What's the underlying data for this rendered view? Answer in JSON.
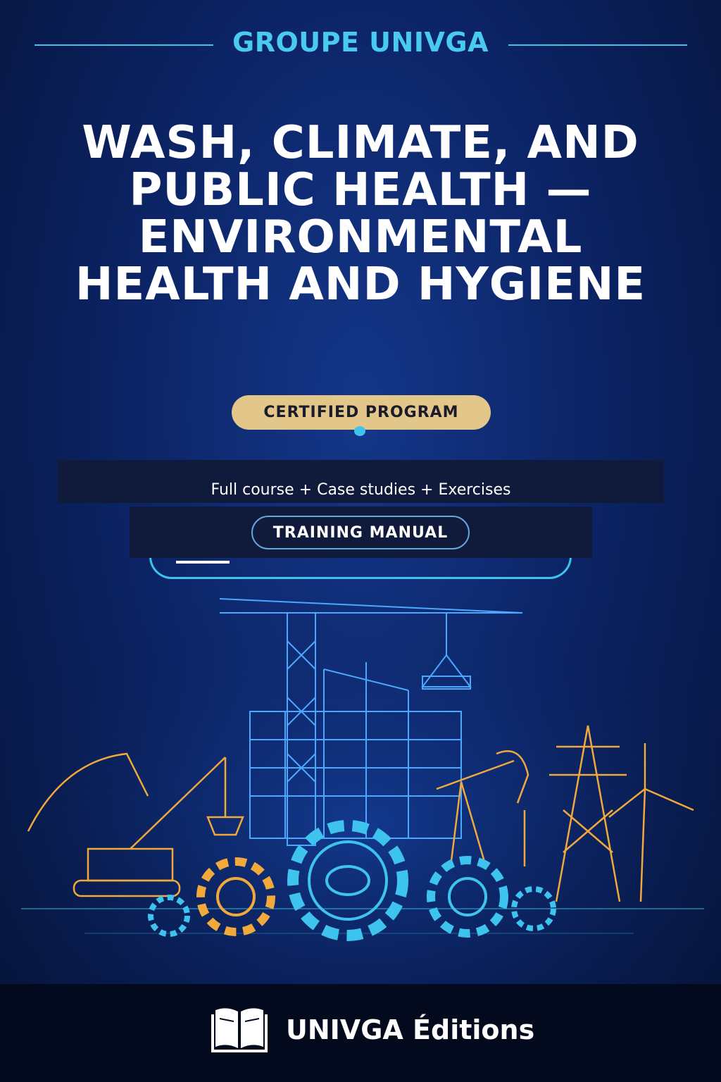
{
  "header": {
    "brand": "GROUPE UNIVGA"
  },
  "cover": {
    "title": "WASH, CLIMATE, AND PUBLIC HEALTH — ENVIRONMENTAL HEALTH AND HYGIENE",
    "badge": "CERTIFIED PROGRAM",
    "subtitle": "Full course + Case studies + Exercises",
    "manual_label": "TRAINING MANUAL"
  },
  "footer": {
    "publisher": "UNIVGA Éditions",
    "logo_icon": "open-book-icon"
  },
  "colors": {
    "accent": "#3ec3ee",
    "gold": "#e2c68a",
    "background": "#0c2466",
    "footer": "#040a1e"
  }
}
